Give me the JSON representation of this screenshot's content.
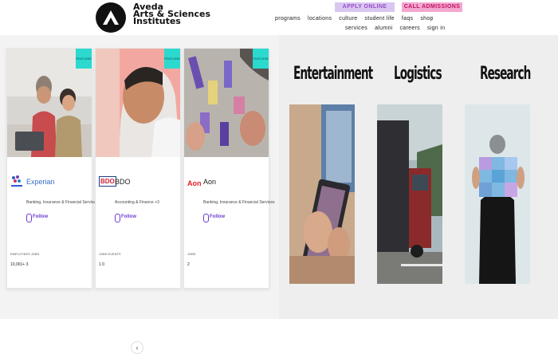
{
  "brand": {
    "line1": "Aveda",
    "line2": "Arts & Sciences",
    "line3": "Institutes"
  },
  "header": {
    "apply_label": "APPLY ONLINE",
    "admissions_label": "CALL ADMISSIONS",
    "nav_primary": [
      "programs",
      "locations",
      "culture",
      "student life",
      "faqs",
      "shop"
    ],
    "nav_secondary": [
      "services",
      "alumni",
      "careers",
      "sign in"
    ]
  },
  "cards": [
    {
      "tag": "FEATURED",
      "company": "Experian",
      "logo_text": "experian",
      "industry": "Banking, Insurance & Financial Services +3",
      "follow": "Follow",
      "stat_labels": "EMPLOYEES   JOBS",
      "stat_values": "10,001+   3"
    },
    {
      "tag": "FEATURED",
      "company": "BDO",
      "logo_text": "BDO",
      "industry": "Accounting & Finance +3",
      "follow": "Follow",
      "stat_labels": "JOBS   EVENTS",
      "stat_values": "1   0"
    },
    {
      "tag": "FEATURED",
      "company": "Aon",
      "logo_text": "Aon",
      "industry": "Banking, Insurance & Financial Services",
      "follow": "Follow",
      "stat_labels": "JOBS",
      "stat_values": "2"
    }
  ],
  "pager_symbol": "‹",
  "categories": [
    {
      "title": "Entertainment"
    },
    {
      "title": "Logistics"
    },
    {
      "title": "Research"
    }
  ],
  "colors": {
    "featured_tag": "#2bd9cf",
    "follow": "#6c3bd1",
    "apply_bg": "#d9c7f1",
    "admissions_bg": "#f3a7d1"
  }
}
